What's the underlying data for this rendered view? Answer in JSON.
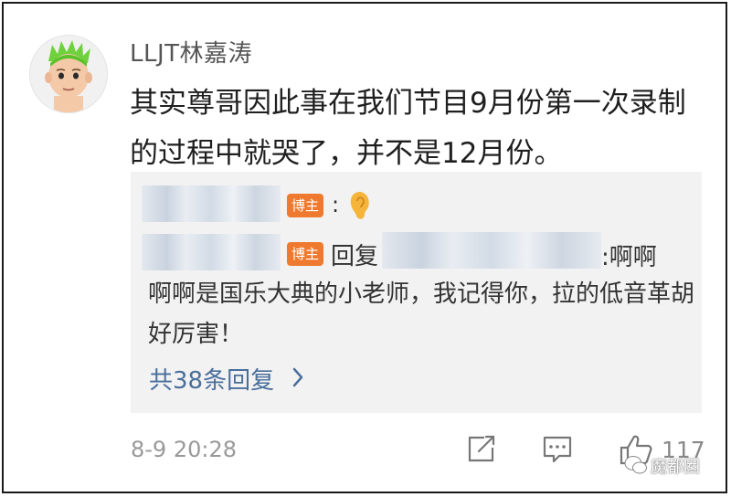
{
  "comment": {
    "username": "LLJT林嘉涛",
    "text": "其实尊哥因此事在我们节目9月份第一次录制的过程中就哭了，并不是12月份。",
    "timestamp": "8-9 20:28",
    "like_count": "117"
  },
  "replies": {
    "line1": {
      "badge": "博主",
      "colon": ":",
      "emoji": "ear-emoji"
    },
    "line2": {
      "badge": "博主",
      "reply_word": "回复",
      "text_part1": ":啊啊",
      "text_part2": "啊啊是国乐大典的小老师，我记得你，拉的低音革胡好厉害！"
    },
    "more_link": "共38条回复"
  },
  "watermark": "魔都囡",
  "colors": {
    "badge": "#ef7a2f",
    "link": "#4a6f9c",
    "reply_bg": "#f2f2f2"
  }
}
